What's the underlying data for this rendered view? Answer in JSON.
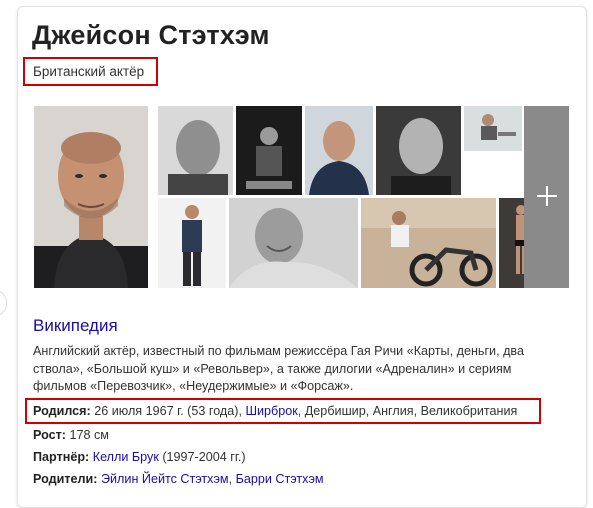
{
  "entity": {
    "name": "Джейсон Стэтхэм",
    "subtitle": "Британский актёр"
  },
  "images": {
    "tiles": [
      {
        "name": "portrait-main"
      },
      {
        "name": "photo-bw-1"
      },
      {
        "name": "photo-stage"
      },
      {
        "name": "photo-jacket"
      },
      {
        "name": "photo-bw-2"
      },
      {
        "name": "photo-gym"
      },
      {
        "name": "photo-standing"
      },
      {
        "name": "photo-laughing"
      },
      {
        "name": "photo-motorbike"
      },
      {
        "name": "photo-diving"
      }
    ],
    "more_icon": "plus-icon"
  },
  "wiki": {
    "title": "Википедия",
    "description": "Английский актёр, известный по фильмам режиссёра Гая Ричи «Карты, деньги, два ствола», «Большой куш» и «Револьвер», а также дилогии «Адреналин» и сериям фильмов «Перевозчик», «Неудержимые» и «Форсаж»."
  },
  "facts": {
    "born": {
      "label": "Родился:",
      "date": " 26 июля 1967 г. (53 года), ",
      "place_link": "Ширброк",
      "place_rest": ", Дербишир, Англия, Великобритания"
    },
    "height": {
      "label": "Рост:",
      "value": " 178 см"
    },
    "partner": {
      "label": "Партнёр:",
      "link": "Келли Брук",
      "rest": " (1997-2004 гг.)"
    },
    "parents": {
      "label": "Родители:",
      "link1": "Эйлин Йейтс Стэтхэм",
      "sep": ", ",
      "link2": "Барри Стэтхэм"
    }
  },
  "colors": {
    "link": "#1a0dab",
    "highlight": "#d10000"
  }
}
